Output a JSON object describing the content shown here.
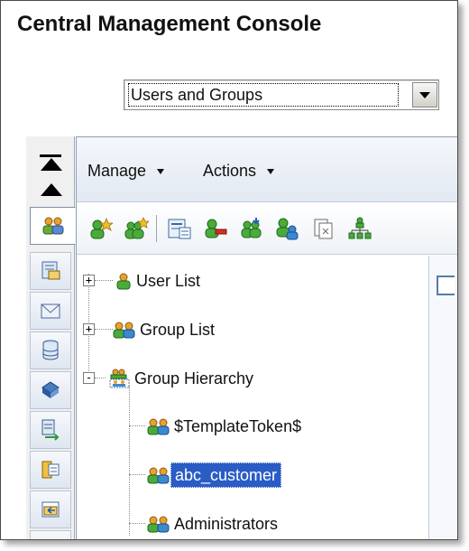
{
  "app": {
    "title": "Central Management Console"
  },
  "view_select": {
    "value": "Users and Groups"
  },
  "menubar": {
    "manage_label": "Manage",
    "actions_label": "Actions"
  },
  "rail": {
    "items": [
      "users-groups-icon",
      "servers-icon",
      "inbox-icon",
      "database-icon",
      "network-icon",
      "replication-icon",
      "calendar-icon",
      "folder-icon"
    ]
  },
  "toolbar": {
    "icons": [
      "new-user-icon",
      "new-group-icon",
      "properties-icon",
      "remove-user-icon",
      "user-security-icon",
      "add-to-group-icon",
      "copy-icon",
      "hierarchy-icon"
    ]
  },
  "tree": {
    "items": [
      {
        "label": "User List",
        "icon": "user-icon",
        "expander": "+"
      },
      {
        "label": "Group List",
        "icon": "group-icon",
        "expander": "+"
      },
      {
        "label": "Group Hierarchy",
        "icon": "group-hierarchy-icon",
        "expander": "-"
      },
      {
        "label": "$TemplateToken$",
        "icon": "group-icon"
      },
      {
        "label": "abc_customer",
        "icon": "group-icon",
        "selected": true
      },
      {
        "label": "Administrators",
        "icon": "group-icon"
      }
    ]
  },
  "colors": {
    "selection": "#2a5cc6",
    "rail_bg": "#f0f0f0",
    "user_green": "#3a9a2a",
    "group_person": "#e0a020"
  }
}
